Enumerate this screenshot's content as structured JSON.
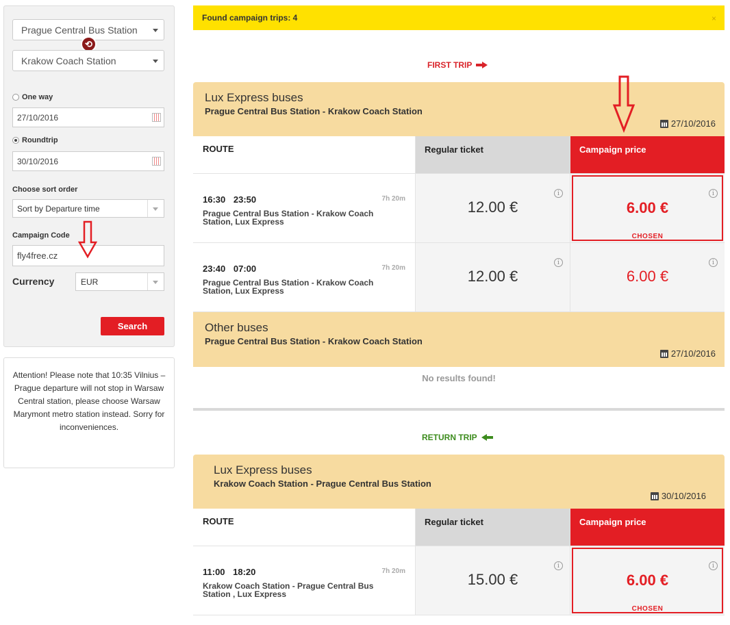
{
  "search": {
    "from": "Prague Central Bus Station",
    "to": "Krakow Coach Station",
    "one_way_label": "One way",
    "depart_date": "27/10/2016",
    "roundtrip_label": "Roundtrip",
    "return_date": "30/10/2016",
    "sort_label": "Choose sort order",
    "sort_value": "Sort by Departure time",
    "campaign_label": "Campaign Code",
    "campaign_value": "fly4free.cz",
    "currency_label": "Currency",
    "currency_value": "EUR",
    "search_button": "Search"
  },
  "notice": "Attention! Please note that 10:35 Vilnius – Prague departure will not stop in Warsaw Central station, please choose Warsaw Marymont metro station instead. Sorry for inconveniences.",
  "banner": {
    "text": "Found campaign trips: 4",
    "close": "×"
  },
  "first_trip": {
    "title": "FIRST TRIP",
    "lux": {
      "name": "Lux Express buses",
      "route": "Prague Central Bus Station  - Krakow Coach Station",
      "date": "27/10/2016",
      "headers": {
        "route": "ROUTE",
        "regular": "Regular ticket",
        "campaign": "Campaign price"
      },
      "rows": [
        {
          "times": "16:30 23:50",
          "duration": "7h 20m",
          "stations": "Prague Central Bus Station  - Krakow Coach Station, Lux Express",
          "regular": "12.00 €",
          "campaign": "6.00 €",
          "chosen": "CHOSEN"
        },
        {
          "times": "23:40 07:00",
          "duration": "7h 20m",
          "stations": "Prague Central Bus Station  - Krakow Coach Station, Lux Express",
          "regular": "12.00 €",
          "campaign": "6.00 €"
        }
      ]
    },
    "other": {
      "name": "Other buses",
      "route": "Prague Central Bus Station  - Krakow Coach Station",
      "date": "27/10/2016",
      "no_results": "No results found!"
    }
  },
  "return_trip": {
    "title": "RETURN TRIP",
    "lux": {
      "name": "Lux Express buses",
      "route": "Krakow Coach Station - Prague Central Bus Station",
      "date": "30/10/2016",
      "headers": {
        "route": "ROUTE",
        "regular": "Regular ticket",
        "campaign": "Campaign price"
      },
      "rows": [
        {
          "times": "11:00 18:20",
          "duration": "7h 20m",
          "stations": "Krakow Coach Station - Prague Central Bus Station , Lux Express",
          "regular": "15.00 €",
          "campaign": "6.00 €",
          "chosen": "CHOSEN"
        }
      ]
    }
  },
  "colors": {
    "accent_red": "#e31e24",
    "banner_yellow": "#ffe100",
    "header_tan": "#f7dba0",
    "return_green": "#3d8c1e"
  }
}
